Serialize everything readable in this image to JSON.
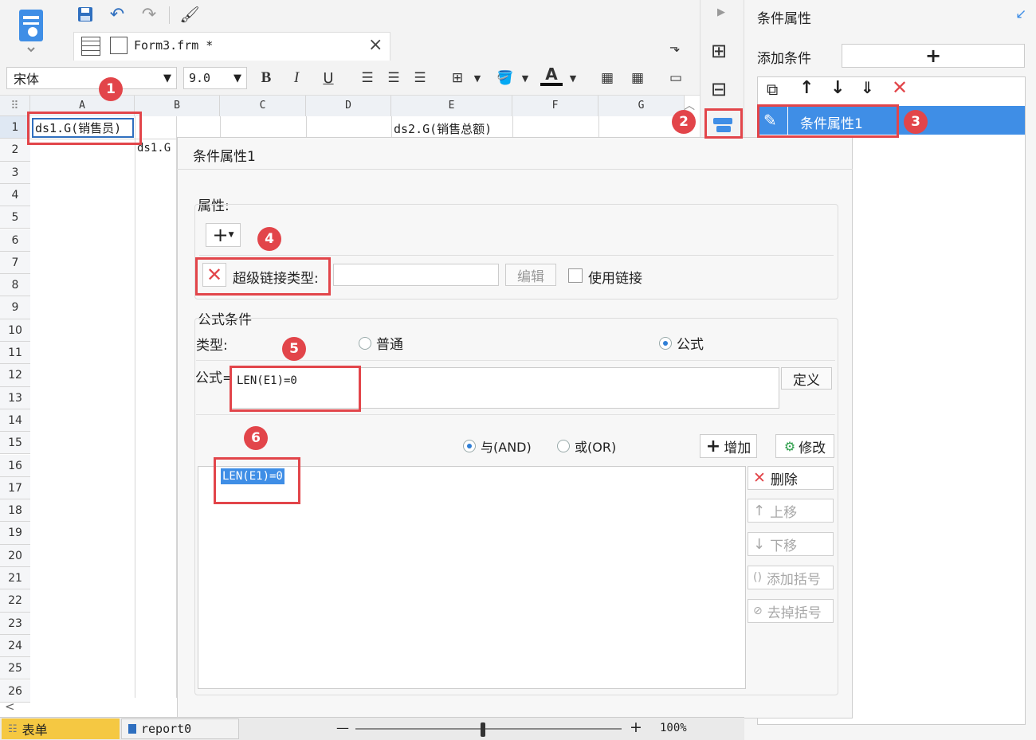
{
  "toolbar": {
    "font_name": "宋体",
    "font_size": "9.0",
    "bold": "B",
    "italic": "I",
    "underline": "U",
    "font_color_letter": "A"
  },
  "tab": {
    "file_name": "Form3.frm *",
    "close": "×"
  },
  "sheet": {
    "columns": [
      "A",
      "B",
      "C",
      "D",
      "E",
      "F",
      "G"
    ],
    "rows": [
      "1",
      "2",
      "3",
      "4",
      "5",
      "6",
      "7",
      "8",
      "9",
      "10",
      "11",
      "12",
      "13",
      "14",
      "15",
      "16",
      "17",
      "18",
      "19",
      "20",
      "21",
      "22",
      "23",
      "24",
      "25",
      "26"
    ],
    "cell_a1": "ds1.G(销售员)",
    "cell_b2": "ds1.G",
    "cell_e1": "ds2.G(销售总额)"
  },
  "right_panel": {
    "title": "条件属性",
    "add_condition_label": "添加条件",
    "add_plus": "+",
    "condition_item": "条件属性1"
  },
  "dialog": {
    "title": "条件属性1",
    "property_label": "属性:",
    "add_prop": "+",
    "hyperlink_label": "超级链接类型:",
    "edit_button": "编辑",
    "use_link_label": "使用链接",
    "formula_section": "公式条件",
    "type_label": "类型:",
    "type_normal": "普通",
    "type_formula": "公式",
    "formula_label": "公式=",
    "formula_value": "LEN(E1)=0",
    "define_button": "定义",
    "and_label": "与(AND)",
    "or_label": "或(OR)",
    "add_button": "增加",
    "modify_button": "修改",
    "delete_button": "删除",
    "move_up_button": "上移",
    "move_down_button": "下移",
    "add_paren_button": "添加括号",
    "remove_paren_button": "去掉括号",
    "condition_list_item": "LEN(E1)=0"
  },
  "badges": [
    "1",
    "2",
    "3",
    "4",
    "5",
    "6"
  ],
  "bottom": {
    "sheet_tab": "表单",
    "report_tab": "report0",
    "zoom": "100%",
    "zoom_minus": "—",
    "zoom_plus": "+"
  },
  "colors": {
    "accent_blue": "#3f8ee6",
    "highlight_red": "#e2454a",
    "selected_row": "#3f8ee6",
    "sheet_tab_bg": "#f5c842"
  }
}
